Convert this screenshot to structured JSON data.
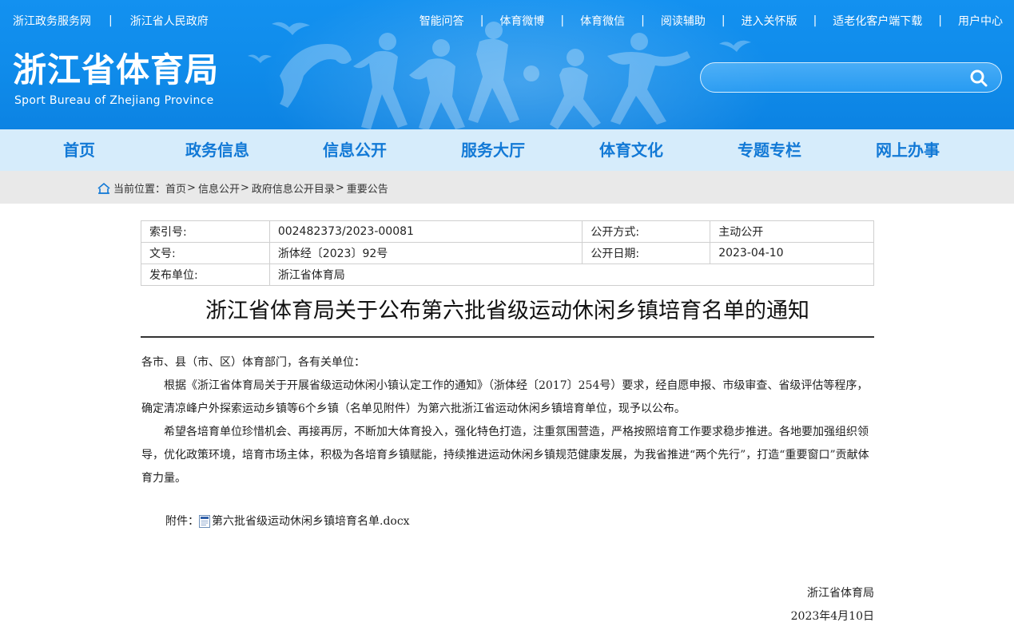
{
  "topbar": {
    "left_links": [
      "浙江政务服务网",
      "浙江省人民政府"
    ],
    "right_links": [
      "智能问答",
      "体育微博",
      "体育微信",
      "阅读辅助",
      "进入关怀版",
      "适老化客户端下载",
      "用户中心"
    ],
    "separator": "|"
  },
  "logo": {
    "cn": "浙江省体育局",
    "en": "Sport Bureau of Zhejiang Province"
  },
  "search": {
    "value": "",
    "placeholder": "",
    "icon": "search-icon"
  },
  "nav": {
    "items": [
      "首页",
      "政务信息",
      "信息公开",
      "服务大厅",
      "体育文化",
      "专题专栏",
      "网上办事"
    ]
  },
  "breadcrumb": {
    "label": "当前位置：",
    "items": [
      "首页",
      "信息公开",
      "政府信息公开目录",
      "重要公告"
    ],
    "separator": ">",
    "icon": "home-icon"
  },
  "meta": {
    "index_label": "索引号:",
    "index_value": "002482373/2023-00081",
    "method_label": "公开方式:",
    "method_value": "主动公开",
    "doc_label": "文号:",
    "doc_value": "浙体经〔2023〕92号",
    "date_label": "公开日期:",
    "date_value": "2023-04-10",
    "publisher_label": "发布单位:",
    "publisher_value": "浙江省体育局"
  },
  "article": {
    "title": "浙江省体育局关于公布第六批省级运动休闲乡镇培育名单的通知",
    "salutation": "各市、县（市、区）体育部门，各有关单位：",
    "para1": "根据《浙江省体育局关于开展省级运动休闲小镇认定工作的通知》（浙体经〔2017〕254号）要求，经自愿申报、市级审查、省级评估等程序，确定清凉峰户外探索运动乡镇等6个乡镇（名单见附件）为第六批浙江省运动休闲乡镇培育单位，现予以公布。",
    "para2": "希望各培育单位珍惜机会、再接再厉，不断加大体育投入，强化特色打造，注重氛围营造，严格按照培育工作要求稳步推进。各地要加强组织领导，优化政策环境，培育市场主体，积极为各培育乡镇赋能，持续推进运动休闲乡镇规范健康发展，为我省推进“两个先行”，打造“重要窗口”贡献体育力量。",
    "attachment_label": "附件：",
    "attachment_name": "第六批省级运动休闲乡镇培育名单.docx",
    "attachment_icon": "word-doc-icon",
    "signature": "浙江省体育局",
    "sign_date": "2023年4月10日"
  },
  "colors": {
    "banner": "#0f8bea",
    "nav_bg": "#d6ecfb",
    "nav_text": "#1279d6",
    "crumb_bg": "#e9e9e9"
  }
}
